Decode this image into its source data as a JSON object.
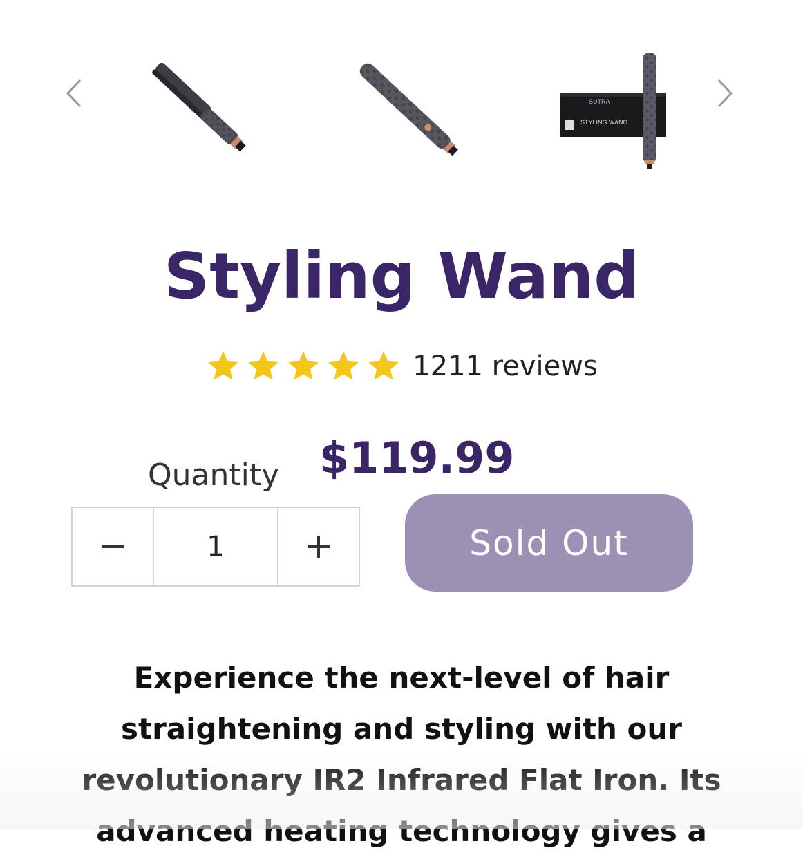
{
  "carousel": {
    "prev_icon": "chevron-left-icon",
    "next_icon": "chevron-right-icon",
    "thumbnails": [
      {
        "name": "styling-wand-open-thumbnail"
      },
      {
        "name": "styling-wand-closed-thumbnail"
      },
      {
        "name": "styling-wand-box-thumbnail",
        "box_brand": "SUTRA",
        "box_label": "STYLING WAND"
      }
    ]
  },
  "product": {
    "title": "Styling Wand",
    "rating_stars": 5,
    "star_color": "#f5c518",
    "reviews": "1211 reviews",
    "price": "$119.99",
    "title_color": "#3a2666"
  },
  "quantity": {
    "label": "Quantity",
    "value": "1",
    "minus_icon": "minus-icon",
    "plus_icon": "plus-icon"
  },
  "buy": {
    "label": "Sold Out",
    "color": "#9b91b5"
  },
  "description": {
    "text": "Experience the next-level of hair straightening and styling with our revolutionary IR2 Infrared Flat Iron. Its advanced heating technology gives a"
  }
}
